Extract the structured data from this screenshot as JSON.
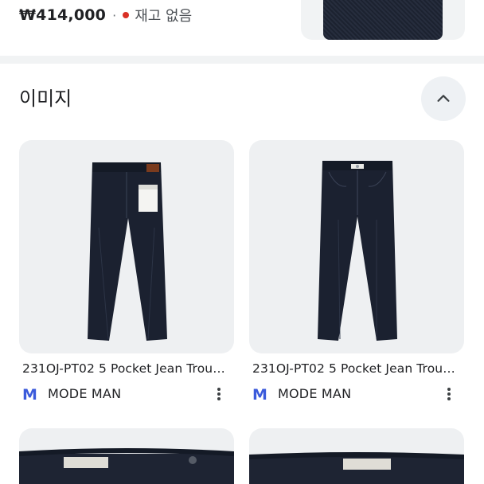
{
  "top_result": {
    "price": "₩414,000",
    "separator": "·",
    "stock_status": "재고 없음",
    "status_color": "#d93025"
  },
  "images_section": {
    "title": "이미지",
    "collapse_icon": "chevron-up-icon"
  },
  "image_results": [
    {
      "caption": "231OJ-PT02 5 Pocket Jean Trou…",
      "source_initial": "M",
      "source": "MODE MAN",
      "menu_icon": "more-vert-icon"
    },
    {
      "caption": "231OJ-PT02 5 Pocket Jean Trou…",
      "source_initial": "M",
      "source": "MODE MAN",
      "menu_icon": "more-vert-icon"
    },
    {
      "caption": "",
      "source_initial": "",
      "source": ""
    },
    {
      "caption": "",
      "source_initial": "",
      "source": ""
    }
  ],
  "colors": {
    "accent_source": "#3b5bdb",
    "denim": "#1c2230",
    "card_bg": "#eef0f2"
  }
}
